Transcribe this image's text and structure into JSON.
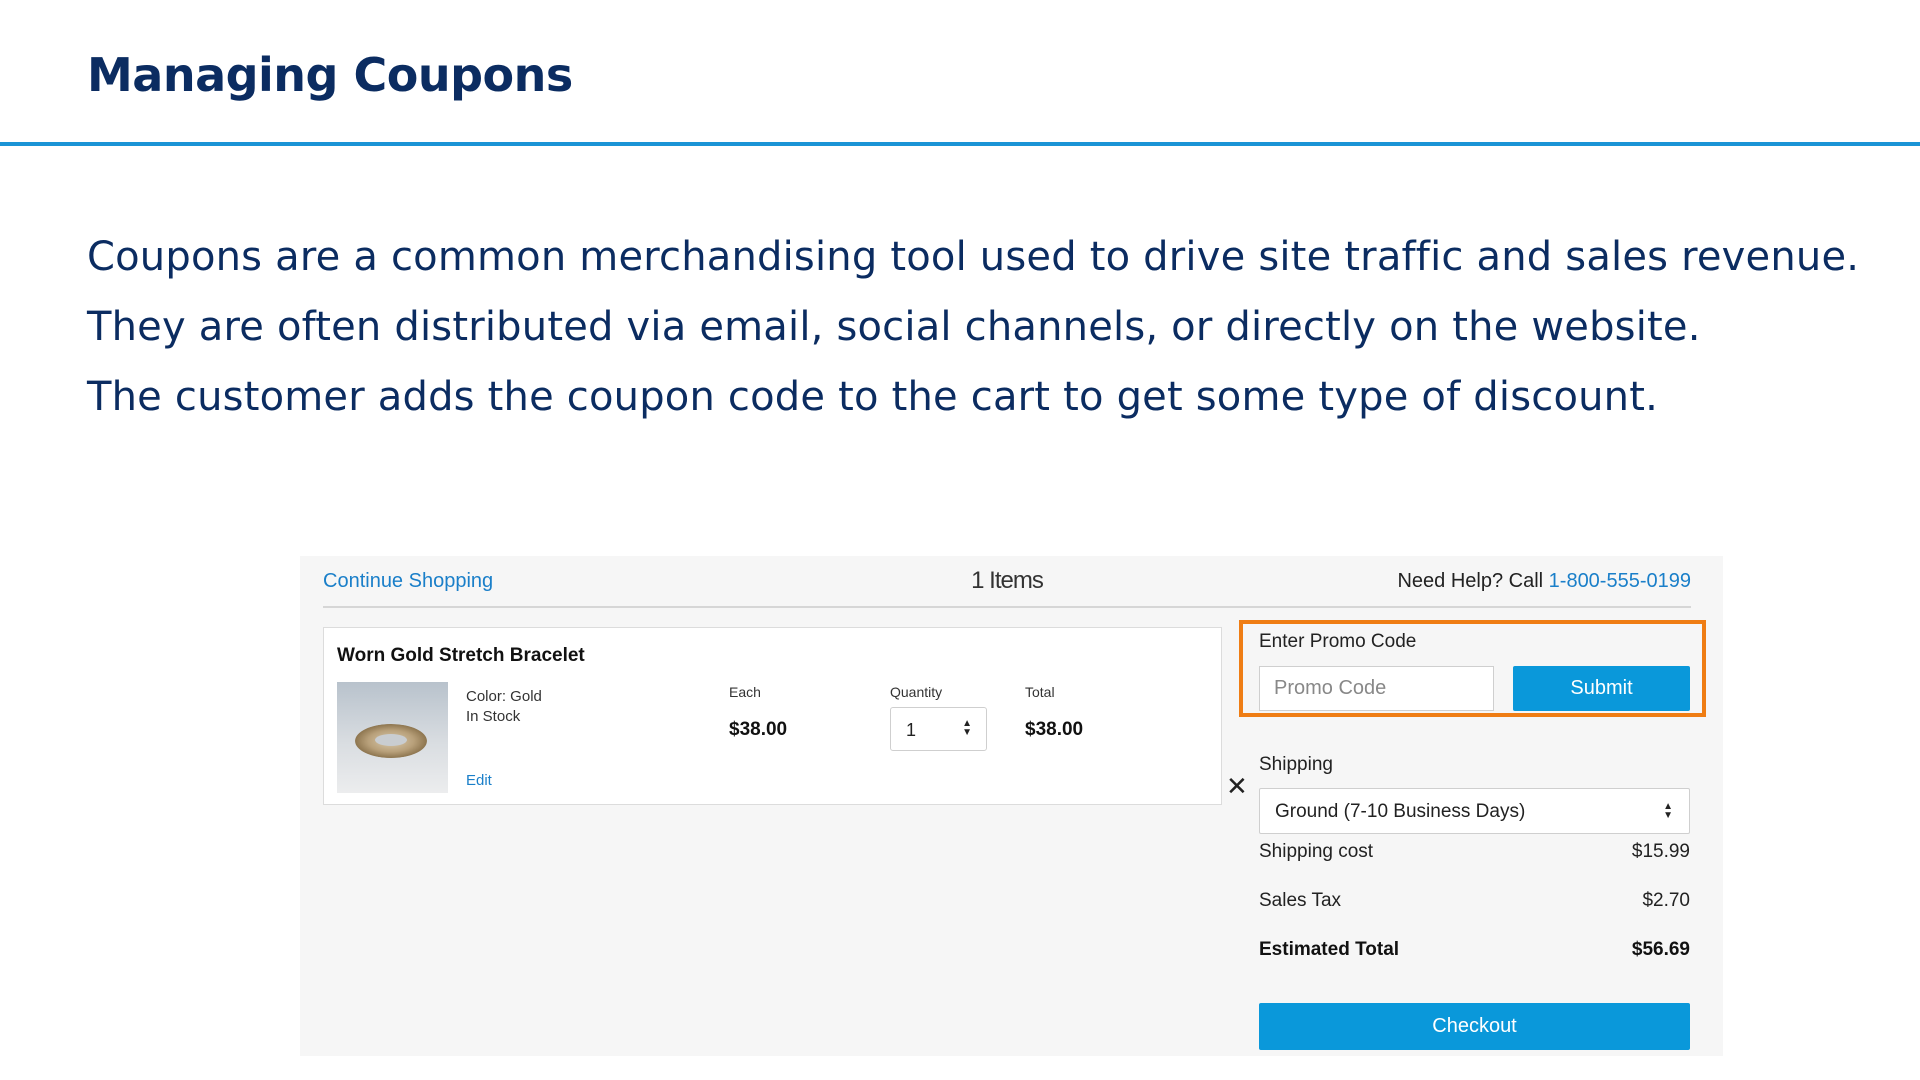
{
  "slide": {
    "title": "Managing Coupons",
    "body_lines": [
      "Coupons are a common merchandising tool used to drive site traffic and sales revenue.",
      "They are often distributed via email, social channels, or directly on the website.",
      "The customer adds the coupon code to the cart to get some type of discount."
    ]
  },
  "cart": {
    "header": {
      "continue_label": "Continue Shopping",
      "items_count": "1 Items",
      "help_prefix": "Need Help? Call ",
      "help_phone": "1-800-555-0199"
    },
    "item": {
      "name": "Worn Gold Stretch Bracelet",
      "color": "Color: Gold",
      "stock": "In Stock",
      "edit_label": "Edit",
      "each_label": "Each",
      "each_price": "$38.00",
      "quantity_label": "Quantity",
      "quantity": "1",
      "total_label": "Total",
      "total_price": "$38.00",
      "remove_icon": "close-icon"
    },
    "promo": {
      "label": "Enter Promo Code",
      "placeholder": "Promo Code",
      "submit_label": "Submit",
      "highlight_color": "#ef7d14"
    },
    "shipping": {
      "label": "Shipping",
      "selected": "Ground (7-10 Business Days)"
    },
    "summary": {
      "shipping_cost_label": "Shipping cost",
      "shipping_cost": "$15.99",
      "sales_tax_label": "Sales Tax",
      "sales_tax": "$2.70",
      "estimated_total_label": "Estimated Total",
      "estimated_total": "$56.69"
    },
    "checkout_label": "Checkout",
    "accent_color": "#0a98da",
    "link_color": "#1a7fc9"
  }
}
